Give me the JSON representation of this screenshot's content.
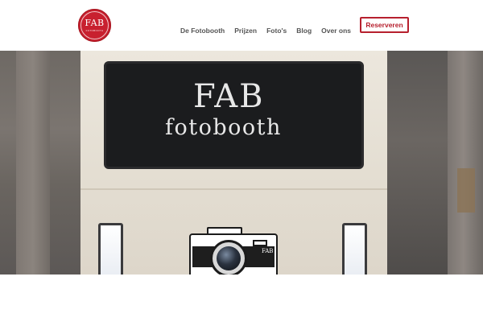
{
  "brand": {
    "logo_text": "FAB",
    "logo_subtext": "FOTOBOOTH",
    "accent_color": "#b7202e"
  },
  "nav": {
    "items": [
      {
        "label": "De Fotobooth"
      },
      {
        "label": "Prijzen"
      },
      {
        "label": "Foto's"
      },
      {
        "label": "Blog"
      },
      {
        "label": "Over ons"
      }
    ],
    "cta_label": "Reserveren"
  },
  "hero": {
    "screen_title": "FAB",
    "screen_subtitle": "fotobooth",
    "camera_label": "FAB"
  },
  "icons": {
    "logo": "fab-logo-icon",
    "camera": "camera-icon"
  }
}
